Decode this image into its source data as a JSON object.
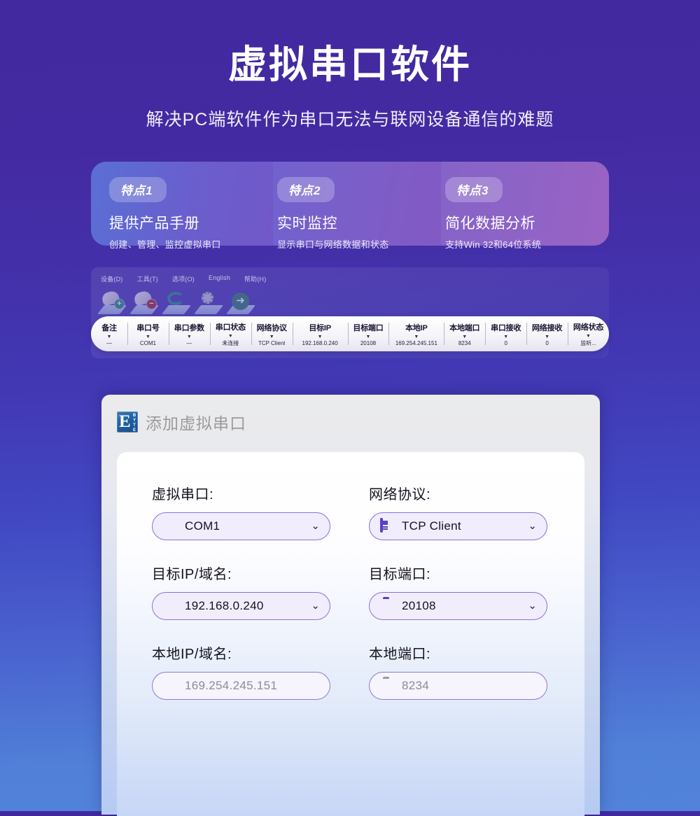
{
  "header": {
    "title": "虚拟串口软件",
    "subtitle": "解决PC端软件作为串口无法与联网设备通信的难题"
  },
  "features": [
    {
      "badge": "特点1",
      "title": "提供产品手册",
      "desc": "创建、管理、监控虚拟串口"
    },
    {
      "badge": "特点2",
      "title": "实时监控",
      "desc": "显示串口与网络数据和状态"
    },
    {
      "badge": "特点3",
      "title": "简化数据分析",
      "desc": "支持Win 32和64位系统"
    }
  ],
  "software_window": {
    "menus": [
      "设备(D)",
      "工具(T)",
      "选项(O)",
      "English",
      "帮助(H)"
    ],
    "toolbar_icons": [
      "add-device-icon",
      "remove-device-icon",
      "refresh-icon",
      "settings-icon",
      "start-icon"
    ],
    "table": {
      "columns": [
        {
          "header": "备注",
          "value": "—"
        },
        {
          "header": "串口号",
          "value": "COM1"
        },
        {
          "header": "串口参数",
          "value": "—"
        },
        {
          "header": "串口状态",
          "value": "未连接"
        },
        {
          "header": "网络协议",
          "value": "TCP Client"
        },
        {
          "header": "目标IP",
          "value": "192.168.0.240"
        },
        {
          "header": "目标端口",
          "value": "20108"
        },
        {
          "header": "本地IP",
          "value": "169.254.245.151"
        },
        {
          "header": "本地端口",
          "value": "8234"
        },
        {
          "header": "串口接收",
          "value": "0"
        },
        {
          "header": "网络接收",
          "value": "0"
        },
        {
          "header": "网络状态",
          "value": "监听..."
        }
      ]
    }
  },
  "dialog": {
    "logo_letter": "E",
    "logo_word": "BYTE",
    "title": "添加虚拟串口",
    "fields": [
      {
        "label": "虚拟串口:",
        "value": "COM1",
        "icon": "serial-port-icon",
        "has_chevron": true,
        "disabled": false
      },
      {
        "label": "网络协议:",
        "value": "TCP Client",
        "icon": "protocol-icon",
        "has_chevron": true,
        "disabled": false
      },
      {
        "label": "目标IP/域名:",
        "value": "192.168.0.240",
        "icon": "location-pin-icon",
        "has_chevron": true,
        "disabled": false
      },
      {
        "label": "目标端口:",
        "value": "20108",
        "icon": "port-icon",
        "has_chevron": true,
        "disabled": false
      },
      {
        "label": "本地IP/域名:",
        "value": "169.254.245.151",
        "icon": "location-pin-icon",
        "has_chevron": false,
        "disabled": true
      },
      {
        "label": "本地端口:",
        "value": "8234",
        "icon": "port-icon",
        "has_chevron": false,
        "disabled": true
      }
    ]
  },
  "colors": {
    "bg_top": "#42299f",
    "bg_bottom": "#5283da",
    "accent_purple": "#6a4fd0",
    "field_border": "#8a6fe0",
    "field_bg": "#f1edfd",
    "logo_blue": "#1f5e9e"
  }
}
